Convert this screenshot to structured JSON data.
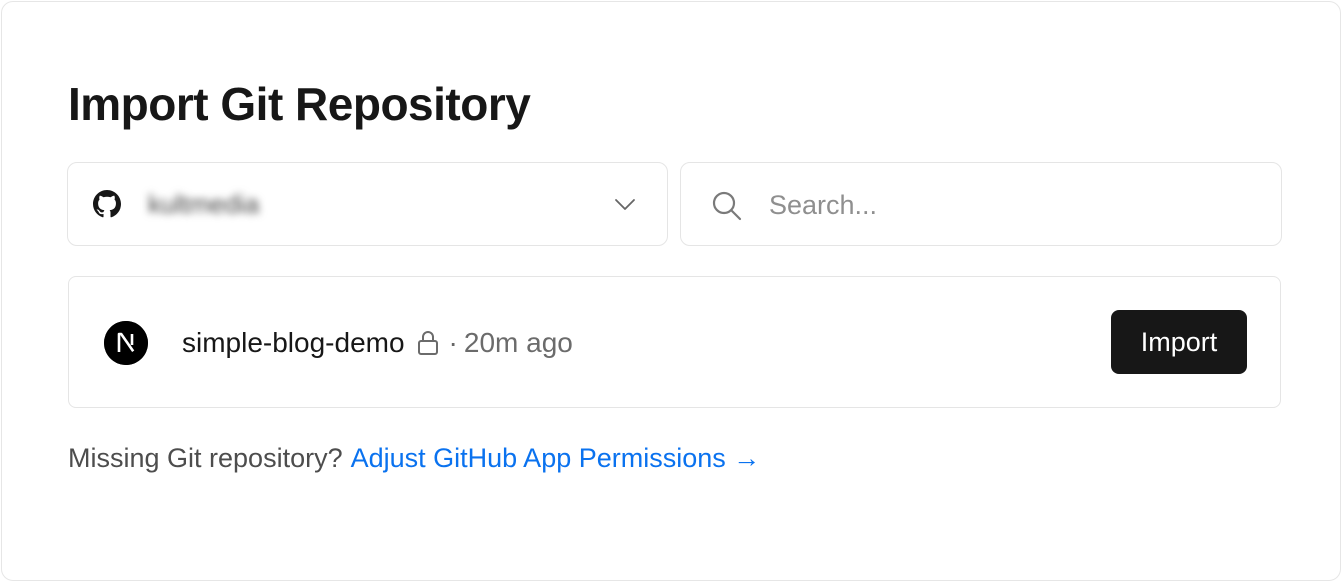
{
  "title": "Import Git Repository",
  "scope_select": {
    "provider_icon": "github-icon",
    "account_name": "kultmedia",
    "chevron_icon": "chevron-down-icon"
  },
  "search": {
    "placeholder": "Search...",
    "value": "",
    "icon": "search-icon"
  },
  "repositories": [
    {
      "avatar_icon": "nextjs-logo-icon",
      "name": "simple-blog-demo",
      "private_icon": "lock-icon",
      "separator": "·",
      "updated": "20m ago",
      "action_label": "Import"
    }
  ],
  "footer": {
    "prompt": "Missing Git repository?",
    "link_label": "Adjust GitHub App Permissions →"
  },
  "colors": {
    "text": "#171717",
    "muted": "#6b6b6b",
    "border": "#e5e5e5",
    "link": "#0a72ef",
    "button_bg": "#171717",
    "button_text": "#ffffff"
  }
}
